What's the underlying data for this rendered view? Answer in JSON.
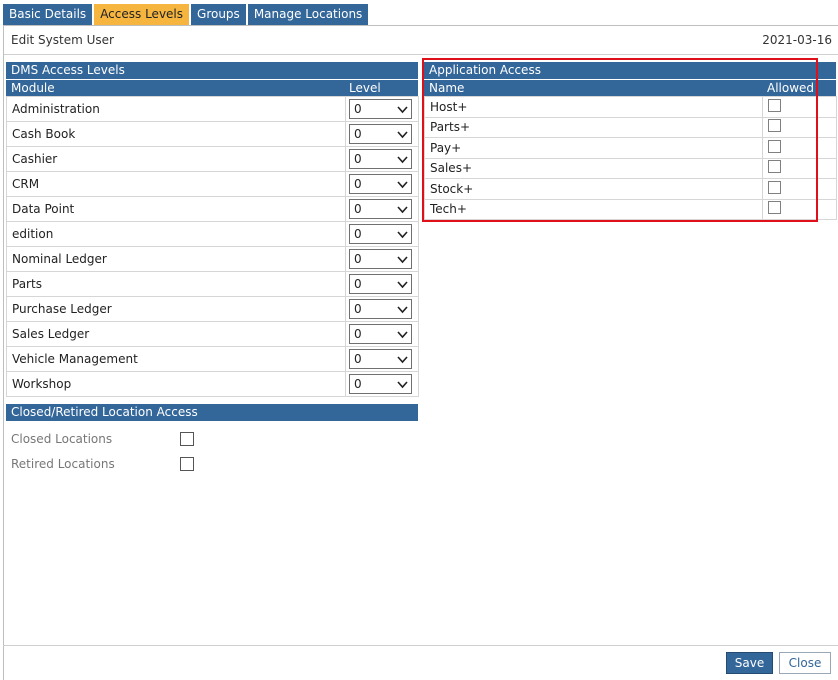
{
  "tabs": [
    {
      "label": "Basic Details",
      "active": false
    },
    {
      "label": "Access Levels",
      "active": true
    },
    {
      "label": "Groups",
      "active": false
    },
    {
      "label": "Manage Locations",
      "active": false
    }
  ],
  "header": {
    "title": "Edit System User",
    "date": "2021-03-16"
  },
  "dms": {
    "title": "DMS Access Levels",
    "col_module": "Module",
    "col_level": "Level",
    "rows": [
      {
        "module": "Administration",
        "level": "0"
      },
      {
        "module": "Cash Book",
        "level": "0"
      },
      {
        "module": "Cashier",
        "level": "0"
      },
      {
        "module": "CRM",
        "level": "0"
      },
      {
        "module": "Data Point",
        "level": "0"
      },
      {
        "module": "edition",
        "level": "0"
      },
      {
        "module": "Nominal Ledger",
        "level": "0"
      },
      {
        "module": "Parts",
        "level": "0"
      },
      {
        "module": "Purchase Ledger",
        "level": "0"
      },
      {
        "module": "Sales Ledger",
        "level": "0"
      },
      {
        "module": "Vehicle Management",
        "level": "0"
      },
      {
        "module": "Workshop",
        "level": "0"
      }
    ]
  },
  "closed": {
    "title": "Closed/Retired Location Access",
    "items": [
      {
        "label": "Closed Locations",
        "checked": false
      },
      {
        "label": "Retired Locations",
        "checked": false
      }
    ]
  },
  "app": {
    "title": "Application Access",
    "col_name": "Name",
    "col_allowed": "Allowed",
    "rows": [
      {
        "name": "Host+",
        "allowed": false
      },
      {
        "name": "Parts+",
        "allowed": false
      },
      {
        "name": "Pay+",
        "allowed": false
      },
      {
        "name": "Sales+",
        "allowed": false
      },
      {
        "name": "Stock+",
        "allowed": false
      },
      {
        "name": "Tech+",
        "allowed": false
      }
    ]
  },
  "footer": {
    "save_label": "Save",
    "close_label": "Close"
  },
  "colors": {
    "accent": "#336699",
    "active_tab": "#f5b53f",
    "highlight": "#e0101a"
  }
}
